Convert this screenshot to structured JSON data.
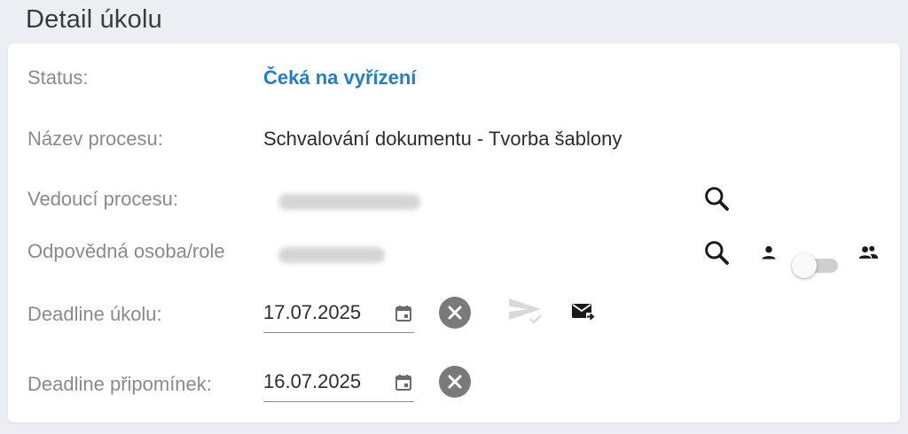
{
  "page": {
    "title": "Detail úkolu"
  },
  "fields": {
    "status": {
      "label": "Status:",
      "value": "Čeká na vyřízení"
    },
    "process_name": {
      "label": "Název procesu:",
      "value": "Schvalování dokumentu - Tvorba šablony"
    },
    "process_lead": {
      "label": "Vedoucí procesu:"
    },
    "responsible": {
      "label": "Odpovědná osoba/role"
    },
    "task_deadline": {
      "label": "Deadline úkolu:",
      "value": "17.07.2025"
    },
    "comments_deadline": {
      "label": "Deadline připomínek:",
      "value": "16.07.2025"
    }
  },
  "colors": {
    "accent": "#1f7fc8",
    "label": "#8a8a8a",
    "text": "#2c2c2c",
    "icon_dark": "#1a1a1a",
    "icon_muted": "#7a7a7a",
    "icon_disabled": "#d9d9d9"
  },
  "icons": {
    "search": "search-icon",
    "calendar": "calendar-icon",
    "clear": "close-circle-icon",
    "send": "send-icon",
    "mail": "mail-send-icon",
    "person": "person-icon",
    "group": "group-icon"
  },
  "toggle": {
    "role_mode_enabled": false
  }
}
